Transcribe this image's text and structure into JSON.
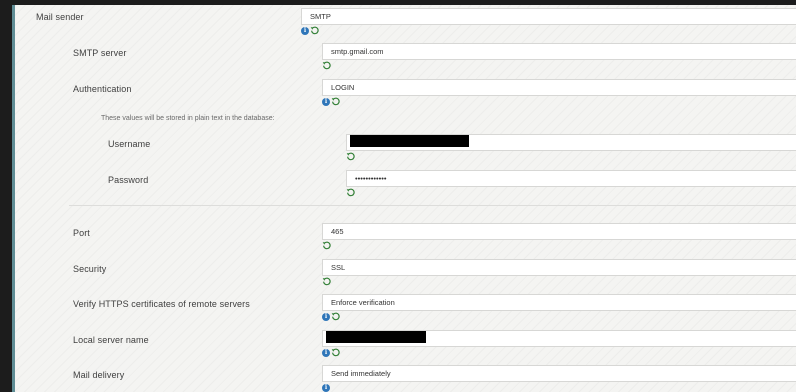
{
  "mail_sender": {
    "label": "Mail sender",
    "value": "SMTP"
  },
  "smtp_server": {
    "label": "SMTP server",
    "value": "smtp.gmail.com"
  },
  "authentication": {
    "label": "Authentication",
    "value": "LOGIN"
  },
  "auth_note": "These values will be stored in plain text in the database:",
  "username": {
    "label": "Username",
    "value": ""
  },
  "password": {
    "label": "Password",
    "value": "••••••••••••"
  },
  "port": {
    "label": "Port",
    "value": "465"
  },
  "security": {
    "label": "Security",
    "value": "SSL"
  },
  "verify_https": {
    "label": "Verify HTTPS certificates of remote servers",
    "value": "Enforce verification"
  },
  "local_server_name": {
    "label": "Local server name",
    "value": ""
  },
  "mail_delivery": {
    "label": "Mail delivery",
    "value": "Send immediately"
  },
  "icons": {
    "info": "info-icon",
    "reset": "reset-icon"
  },
  "colors": {
    "accent_border": "#5f8d95",
    "info": "#2f76b9",
    "reset": "#2e7d32"
  }
}
